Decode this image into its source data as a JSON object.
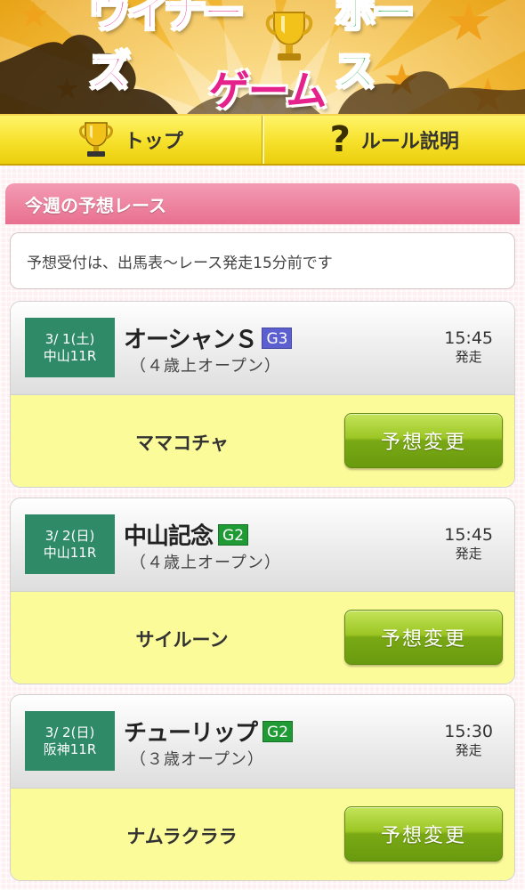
{
  "banner": {
    "title_line1_part1": "ウイナーズ",
    "title_line1_part2": "ホース",
    "title_line2": "ゲーム",
    "colors": {
      "pink": "#e5218c",
      "green": "#21a84a",
      "gold": "#f7c64a"
    }
  },
  "nav": {
    "top_label": "トップ",
    "rules_label": "ルール説明",
    "top_icon": "trophy-icon",
    "rules_icon": "question-icon"
  },
  "section": {
    "title": "今週の予想レース",
    "notice": "予想受付は、出馬表～レース発走15分前です"
  },
  "races": [
    {
      "date": "3/ 1(土)",
      "venue": "中山11R",
      "name": "オーシャンＳ",
      "grade": "G3",
      "grade_color": "#5b5fd0",
      "condition": "（４歳上オープン）",
      "time": "15:45",
      "time_label": "発走",
      "horse": "ママコチャ",
      "button": "予想変更"
    },
    {
      "date": "3/ 2(日)",
      "venue": "中山11R",
      "name": "中山記念",
      "grade": "G2",
      "grade_color": "#1f9a35",
      "condition": "（４歳上オープン）",
      "time": "15:45",
      "time_label": "発走",
      "horse": "サイルーン",
      "button": "予想変更"
    },
    {
      "date": "3/ 2(日)",
      "venue": "阪神11R",
      "name": "チューリップ",
      "grade": "G2",
      "grade_color": "#1f9a35",
      "condition": "（３歳オープン）",
      "time": "15:30",
      "time_label": "発走",
      "horse": "ナムラクララ",
      "button": "予想変更"
    }
  ]
}
